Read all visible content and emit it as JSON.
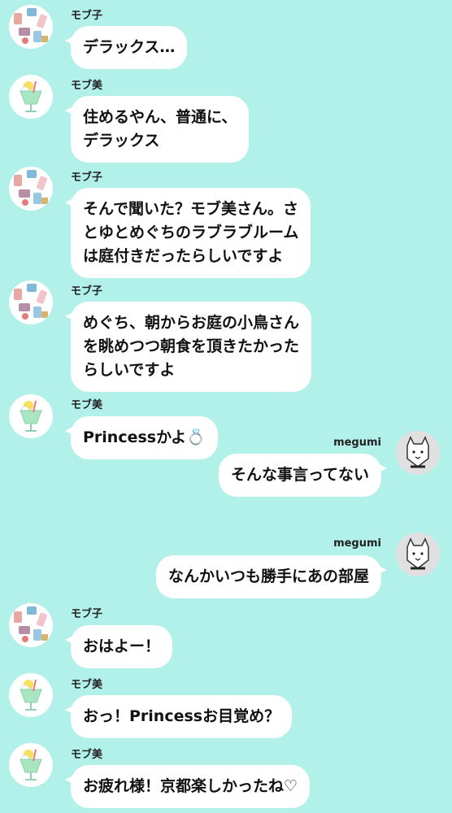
{
  "theme": {
    "background": "#b2f0ea",
    "bubble": "#ffffff"
  },
  "messages": [
    {
      "sender": "モブ子",
      "avatar_icon": "cosmetics-collage-icon",
      "lines": [
        "デラックス…"
      ]
    },
    {
      "sender": "モブ美",
      "avatar_icon": "cream-soda-drink-icon",
      "lines": [
        "住めるやん、普通に、",
        "デラックス"
      ]
    },
    {
      "sender": "モブ子",
      "avatar_icon": "cosmetics-collage-icon",
      "lines": [
        "そんで聞いた？モブ美さん。さ",
        "とゆとめぐちのラブラブルーム",
        "は庭付きだったらしいですよ"
      ]
    },
    {
      "sender": "モブ子",
      "avatar_icon": "cosmetics-collage-icon",
      "lines": [
        "めぐち、朝からお庭の小鳥さん",
        "を眺めつつ朝食を頂きたかった",
        "らしいですよ"
      ]
    },
    {
      "sender": "モブ美",
      "avatar_icon": "cream-soda-drink-icon",
      "lines": [
        "Princessかよ💍"
      ]
    },
    {
      "sender": "megumi",
      "avatar_icon": "wolf-sketch-icon",
      "lines": [
        "そんな事言ってない"
      ]
    },
    {
      "sender": "megumi",
      "avatar_icon": "wolf-sketch-icon",
      "lines": [
        "なんかいつも勝手にあの部屋"
      ]
    },
    {
      "sender": "モブ子",
      "avatar_icon": "cosmetics-collage-icon",
      "lines": [
        "おはよー！"
      ]
    },
    {
      "sender": "モブ美",
      "avatar_icon": "cream-soda-drink-icon",
      "lines": [
        "おっ！Princessお目覚め？"
      ]
    },
    {
      "sender": "モブ美",
      "avatar_icon": "cream-soda-drink-icon",
      "lines": [
        "お疲れ様！京都楽しかったね♡"
      ]
    }
  ]
}
